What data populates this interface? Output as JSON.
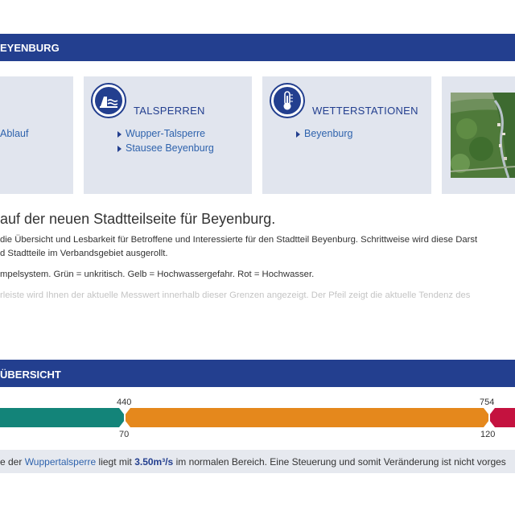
{
  "section1": {
    "title": "EYENBURG"
  },
  "tiles": [
    {
      "links": [
        "Ablauf"
      ]
    },
    {
      "title": "TALSPERREN",
      "icon": "dam-icon",
      "links": [
        "Wupper-Talsperre",
        "Stausee Beyenburg"
      ]
    },
    {
      "title": "WETTERSTATIONEN",
      "icon": "thermometer-icon",
      "links": [
        "Beyenburg"
      ]
    },
    {
      "image": "aerial-photo"
    }
  ],
  "intro": {
    "headline": "auf der neuen Stadtteilseite für Beyenburg.",
    "line1": "die Übersicht und Lesbarkeit für Betroffene und Interessierte für den Stadtteil Beyenburg. Schrittweise wird diese Darst",
    "line2": "d Stadtteile im Verbandsgebiet ausgerollt.",
    "line3": "mpelsystem. Grün = unkritisch. Gelb = Hochwassergefahr. Rot = Hochwasser.",
    "line4": "rleiste wird Ihnen der aktuelle Messwert innerhalb dieser Grenzen angezeigt. Der Pfeil zeigt die aktuelle Tendenz des"
  },
  "section2": {
    "title": "ÜBERSICHT"
  },
  "gauge": {
    "top_labels": [
      "440",
      "754"
    ],
    "bottom_labels": [
      "70",
      "120"
    ],
    "colors": {
      "green": "#138479",
      "yellow": "#e5881c",
      "red": "#c4123f"
    }
  },
  "info": {
    "prefix": "e der ",
    "link": "Wuppertalsperre",
    "middle": " liegt mit ",
    "value": "3.50m³/s",
    "suffix": " im normalen Bereich. Eine Steuerung und somit Veränderung ist nicht vorges"
  }
}
